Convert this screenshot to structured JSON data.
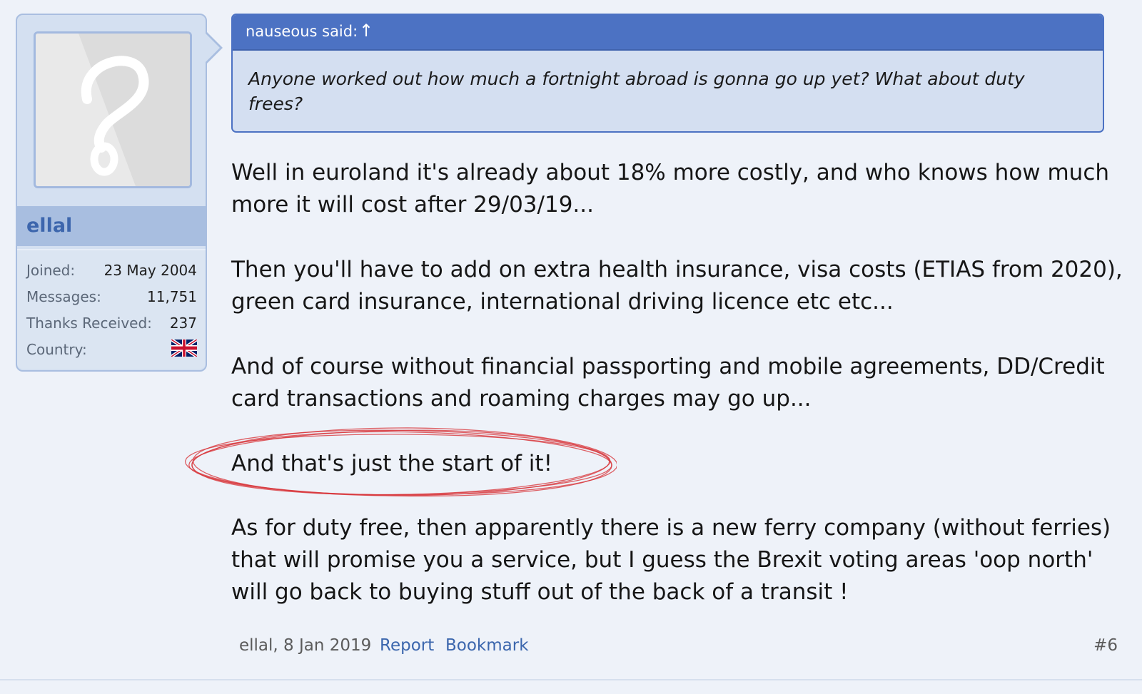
{
  "user": {
    "name": "ellal",
    "stats": [
      {
        "label": "Joined:",
        "value": "23 May 2004"
      },
      {
        "label": "Messages:",
        "value": "11,751"
      },
      {
        "label": "Thanks Received:",
        "value": "237"
      },
      {
        "label": "Country:",
        "value": ""
      }
    ],
    "avatar_icon": "question-mark-placeholder",
    "country_flag_icon": "uk-flag-icon"
  },
  "quote": {
    "author_line": "nauseous said:",
    "jump_arrow": "↑",
    "text": "Anyone worked out how much a fortnight abroad is gonna go up yet? What about duty frees?"
  },
  "message": {
    "paragraphs": [
      "Well in euroland it's already about 18% more costly, and who knows how much more it will cost after 29/03/19...",
      "Then you'll have to add on extra health insurance, visa costs (ETIAS from 2020), green card insurance, international driving licence etc etc...",
      "And of course without financial passporting and mobile agreements, DD/Credit card transactions and roaming charges may go up...",
      "And that's just the start of it!",
      "As for duty free, then apparently there is a new ferry company (without ferries) that will promise you a service, but I guess the Brexit voting areas 'oop north' will go back to buying stuff out of the back of a transit !"
    ],
    "highlight_color": "#d8383d"
  },
  "footer": {
    "meta": "ellal, 8 Jan 2019",
    "report_label": "Report",
    "bookmark_label": "Bookmark",
    "post_number": "#6"
  },
  "colors": {
    "page_bg": "#eef2f9",
    "quote_header": "#4c72c3",
    "link": "#3b66ad",
    "sidebar_bg": "#d4e0f1"
  }
}
